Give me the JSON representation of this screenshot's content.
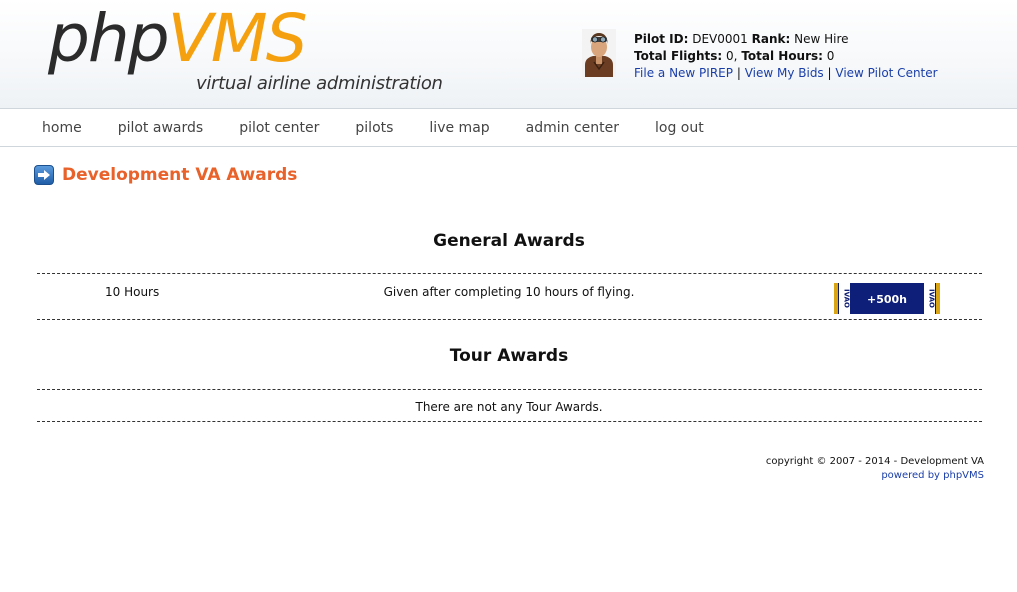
{
  "header": {
    "logo": {
      "part1": "php",
      "part2": "VMS",
      "subtitle": "virtual airline administration"
    },
    "pilot": {
      "id_label": "Pilot ID:",
      "id_value": "DEV0001",
      "rank_label": "Rank:",
      "rank_value": "New Hire",
      "flights_label": "Total Flights:",
      "flights_value": "0,",
      "hours_label": "Total Hours:",
      "hours_value": "0",
      "links": [
        "File a New PIREP",
        "View My Bids",
        "View Pilot Center"
      ],
      "separator": "|"
    }
  },
  "nav": {
    "items": [
      "home",
      "pilot awards",
      "pilot center",
      "pilots",
      "live map",
      "admin center",
      "log out"
    ]
  },
  "main": {
    "title": "Development VA Awards",
    "general": {
      "title": "General Awards",
      "awards": [
        {
          "name": "10 Hours",
          "description": "Given after completing 10 hours of flying.",
          "badge_text": "+500h",
          "badge_side_text": "IVAO"
        }
      ]
    },
    "tour": {
      "title": "Tour Awards",
      "empty_text": "There are not any Tour Awards."
    }
  },
  "footer": {
    "copyright": "copyright © 2007 - 2014 - Development VA",
    "powered": "powered by phpVMS"
  },
  "colors": {
    "accent_orange": "#f5a00f",
    "title_orange": "#e8622a",
    "link_blue": "#1a3ea8"
  }
}
